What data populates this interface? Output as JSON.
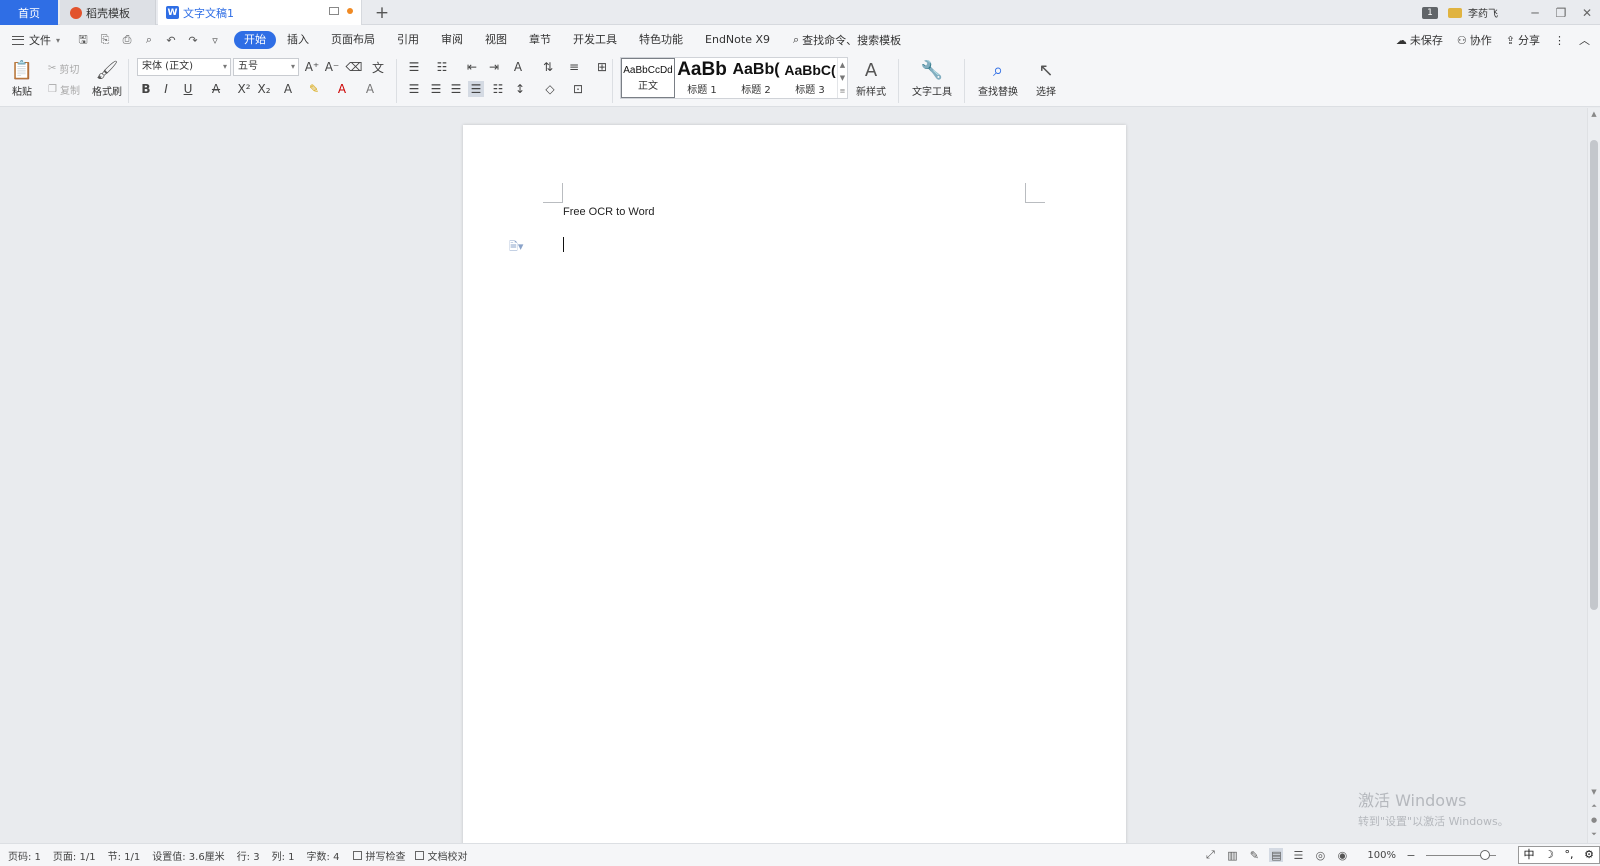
{
  "tabs": {
    "home": "首页",
    "templates": "稻壳模板",
    "document": "文字文稿1",
    "add": "+"
  },
  "window": {
    "badge": "1",
    "user": "李药飞",
    "minimize": "─",
    "restore": "❐",
    "close": "✕"
  },
  "menu": {
    "file": "文件",
    "items": [
      "开始",
      "插入",
      "页面布局",
      "引用",
      "审阅",
      "视图",
      "章节",
      "开发工具",
      "特色功能",
      "EndNote X9"
    ],
    "active_index": 0,
    "search_cmd": "查找命令、搜索模板",
    "unsaved": "未保存",
    "collab": "协作",
    "share": "分享"
  },
  "ribbon": {
    "paste": "粘贴",
    "cut": "剪切",
    "copy": "复制",
    "format_painter": "格式刷",
    "font_name": "宋体 (正文)",
    "font_size": "五号",
    "styles": [
      {
        "sample": "AaBbCcDd",
        "name": "正文"
      },
      {
        "sample": "AaBb",
        "name": "标题 1"
      },
      {
        "sample": "AaBb(",
        "name": "标题 2"
      },
      {
        "sample": "AaBbC(",
        "name": "标题 3"
      }
    ],
    "new_style": "新样式",
    "text_tools": "文字工具",
    "find_replace": "查找替换",
    "select": "选择"
  },
  "document": {
    "text": "Free OCR to Word"
  },
  "watermark": {
    "title": "激活 Windows",
    "subtitle": "转到\"设置\"以激活 Windows。"
  },
  "status": {
    "page_no": "页码: 1",
    "pages": "页面: 1/1",
    "section": "节: 1/1",
    "setting": "设置值: 3.6厘米",
    "row": "行: 3",
    "col": "列: 1",
    "words": "字数: 4",
    "spell_check": "拼写检查",
    "doc_proof": "文档校对",
    "zoom": "100%",
    "ime": [
      "中",
      "☽",
      "°,",
      "⚙"
    ]
  },
  "colors": {
    "accent": "#2f6ee5",
    "doc_tab_dot": "#f08a24"
  }
}
